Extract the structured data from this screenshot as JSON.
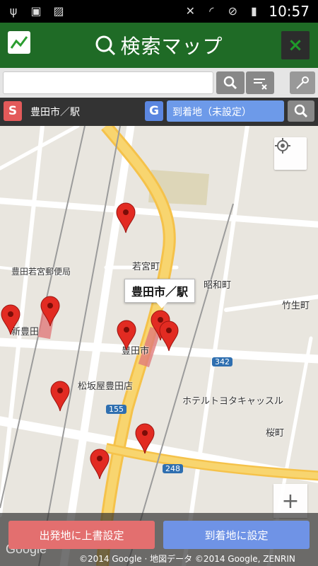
{
  "status": {
    "time": "10:57"
  },
  "app": {
    "title": "検索マップ",
    "close": "×"
  },
  "search": {
    "placeholder": ""
  },
  "route": {
    "start_badge": "S",
    "start": "豊田市／駅",
    "dest_badge": "G",
    "dest": "到着地（未設定）"
  },
  "map": {
    "callout": "豊田市／駅",
    "labels": [
      "若宮町",
      "昭和町",
      "竹生町",
      "豊田若宮郵便局",
      "新豊田",
      "豊田市",
      "松坂屋豊田店",
      "ホテルトヨタキャッスル",
      "桜町",
      "342",
      "155",
      "248"
    ],
    "pin_count": 9,
    "google": "Google",
    "copyright": "©2014 Google · 地図データ ©2014 Google, ZENRIN"
  },
  "buttons": {
    "start": "出発地に上書設定",
    "dest": "到着地に設定"
  }
}
